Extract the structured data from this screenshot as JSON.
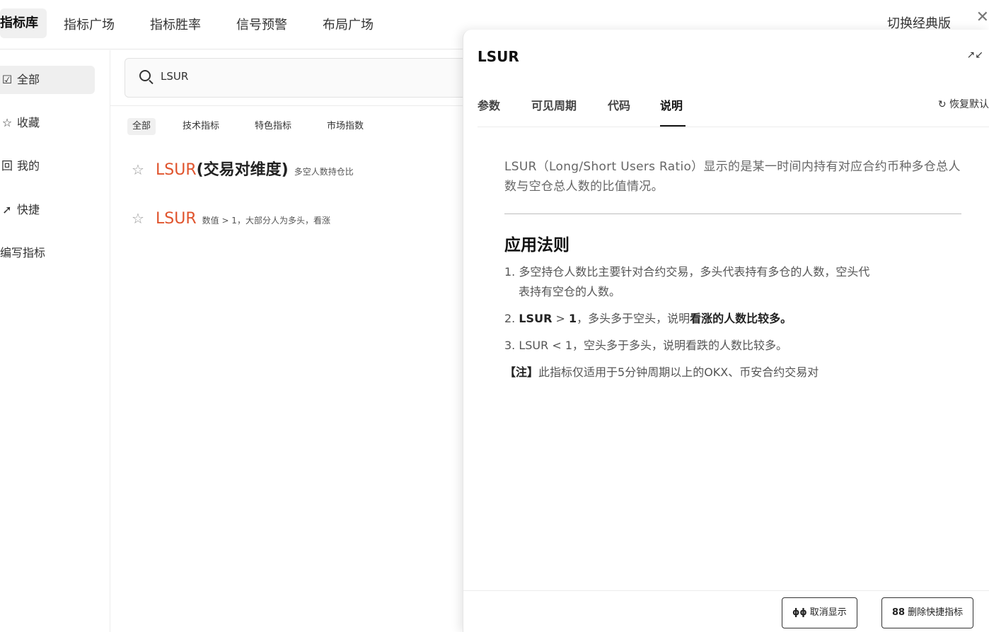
{
  "topbar": {
    "tabs": [
      "指标库",
      "指标广场",
      "指标胜率",
      "信号预警",
      "布局广场"
    ],
    "switch_label": "切换经典版",
    "close_glyph": "✕"
  },
  "sidebar": {
    "items": [
      {
        "icon": "☑",
        "label": "全部"
      },
      {
        "icon": "☆",
        "label": "收藏"
      },
      {
        "icon": "回",
        "label": "我的"
      },
      {
        "icon": "➚",
        "label": "快捷"
      },
      {
        "icon": "",
        "label": "编写指标"
      }
    ]
  },
  "search": {
    "value": "LSUR"
  },
  "filters": [
    "全部",
    "技术指标",
    "特色指标",
    "市场指数"
  ],
  "results": [
    {
      "name": "LSUR",
      "cn": "(交易对维度)",
      "desc": "多空人数持仓比"
    },
    {
      "name": "LSUR",
      "cn": "",
      "desc": "数值 > 1，大部分人为多头，看涨"
    }
  ],
  "panel": {
    "title": "LSUR",
    "tabs": [
      "参数",
      "可见周期",
      "代码",
      "说明"
    ],
    "reset_label": "恢复默认",
    "intro": "LSUR（Long/Short Users Ratio）显示的是某一时间内持有对应合约币种多仓总人数与空仓总人数的比值情况。",
    "rules_title": "应用法则",
    "rule1_a": "1. 多空持仓人数比主要针对合约交易，多头代表持有多仓的人数，空头代",
    "rule1_b": "表持有空仓的人数。",
    "rule2_prefix": "2. ",
    "rule2_bold": "LSUR",
    "rule2_gt": " > ",
    "rule2_one": "1",
    "rule2_mid": "，多头多于空头，说明",
    "rule2_end": "看涨的人数比较多。",
    "rule3": "3. LSUR < 1，空头多于多头，说明看跌的人数比较多。",
    "note_label": "【注】",
    "note_text": "此指标仅适用于5分钟周期以上的OKX、币安合约交易对",
    "btn_hide": "取消显示",
    "btn_hide_icon": "ɸɸ",
    "btn_delete": "删除快捷指标",
    "btn_delete_icon": "88"
  }
}
